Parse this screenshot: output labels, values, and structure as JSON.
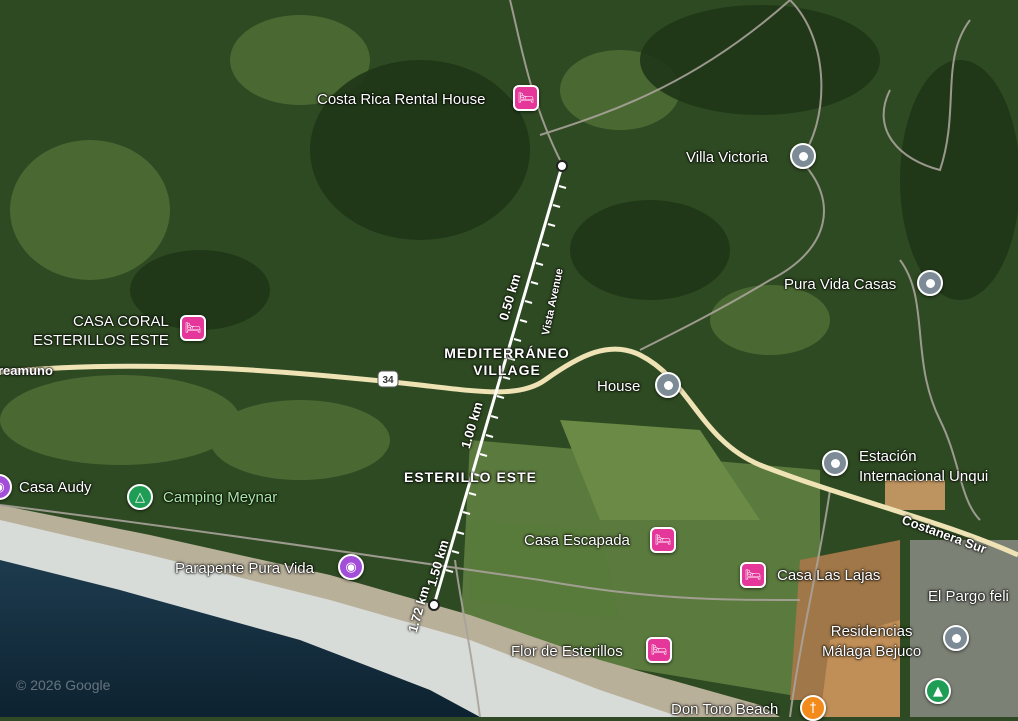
{
  "map": {
    "copyright": "© 2026 Google",
    "colors": {
      "road": "#e8d8a6",
      "measure_line": "#ffffff",
      "hotel_pin": "#e5379a",
      "place_pin": "#7d8b96",
      "camp_pin": "#1f9d55",
      "photo_pin": "#a24ed8",
      "food_pin": "#f28a1c"
    },
    "roads": {
      "route_shield": "34",
      "left_road": "reamuno",
      "costanera": "Costanera Sur",
      "vista": "Vista Avenue"
    },
    "areas": {
      "mediterraneo_1": "MEDITERRÁNEO",
      "mediterraneo_2": "VILLAGE",
      "esterillo": "ESTERILLO ESTE"
    },
    "measure": {
      "marks": [
        "0.50 km",
        "1.00 km",
        "1.50 km",
        "1.72 km"
      ]
    },
    "places": {
      "costa_rica_rental": "Costa Rica Rental House",
      "villa_victoria": "Villa Victoria",
      "pura_vida_casas": "Pura Vida Casas",
      "casa_coral_1": "CASA CORAL",
      "casa_coral_2": "ESTERILLOS ESTE",
      "house": "House",
      "estacion_1": "Estación",
      "estacion_2": "Internacional Unqui",
      "casa_audy": "Casa Audy",
      "camping": "Camping Meynar",
      "casa_escapada": "Casa Escapada",
      "parapente": "Parapente Pura Vida",
      "casa_las_lajas": "Casa Las Lajas",
      "el_pargo": "El Pargo feli",
      "residencias_1": "Residencias",
      "residencias_2": "Málaga Bejuco",
      "flor": "Flor de Esterillos",
      "don_toro": "Don Toro Beach"
    },
    "icons": {
      "hotel": "hotel-bed-icon",
      "place": "place-pin-icon",
      "camp": "campground-icon",
      "photo": "camera-icon",
      "food": "restaurant-icon",
      "park": "park-tree-icon"
    }
  }
}
